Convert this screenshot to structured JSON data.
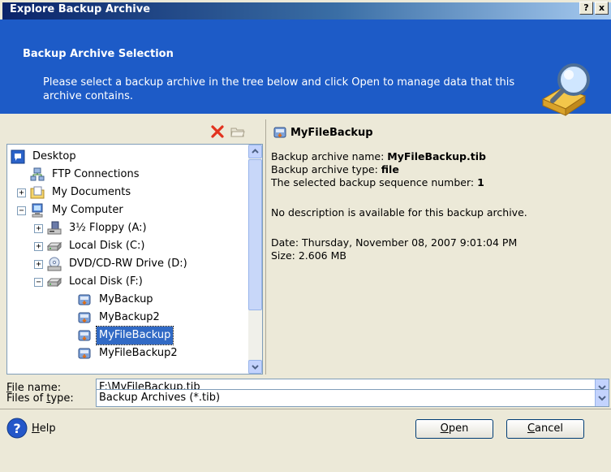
{
  "window": {
    "title": "Explore Backup Archive",
    "help_glyph": "?",
    "close_glyph": "x"
  },
  "header": {
    "title": "Backup Archive Selection",
    "description": "Please select a backup archive in the tree below and click Open to manage data that this archive contains."
  },
  "tree": {
    "items": [
      {
        "label": "Desktop"
      },
      {
        "label": "FTP Connections"
      },
      {
        "label": "My Documents",
        "expander": "+"
      },
      {
        "label": "My Computer",
        "expander": "−"
      },
      {
        "label": "3½ Floppy (A:)",
        "expander": "+"
      },
      {
        "label": "Local Disk (C:)",
        "expander": "+"
      },
      {
        "label": "DVD/CD-RW Drive (D:)",
        "expander": "+"
      },
      {
        "label": "Local Disk (F:)",
        "expander": "−"
      },
      {
        "label": "MyBackup"
      },
      {
        "label": "MyBackup2"
      },
      {
        "label": "MyFileBackup",
        "selected": true
      },
      {
        "label": "MyFileBackup2"
      }
    ]
  },
  "details": {
    "archive_title": "MyFileBackup",
    "name_label": "Backup archive name:",
    "name_value": "MyFileBackup.tib",
    "type_label": "Backup archive type:",
    "type_value": "file",
    "sequence_label": "The selected backup sequence number:",
    "sequence_value": "1",
    "description": "No description is available for this backup archive.",
    "date": "Date: Thursday, November 08, 2007 9:01:04 PM",
    "size": "Size: 2.606 MB"
  },
  "form": {
    "file_name_label_u": "F",
    "file_name_label_rest": "ile name:",
    "file_name_value": "F:\\MyFileBackup.tib",
    "files_of_type_label_pre": "Files of ",
    "files_of_type_label_u": "t",
    "files_of_type_label_rest": "ype:",
    "files_of_type_value": "Backup Archives (*.tib)"
  },
  "footer": {
    "help_u": "H",
    "help_rest": "elp",
    "open_u": "O",
    "open_rest": "pen",
    "cancel_u": "C",
    "cancel_rest": "ancel"
  },
  "colors": {
    "header_bg": "#1d5bc7",
    "selection": "#316ac5",
    "delete_red": "#e2321e"
  }
}
